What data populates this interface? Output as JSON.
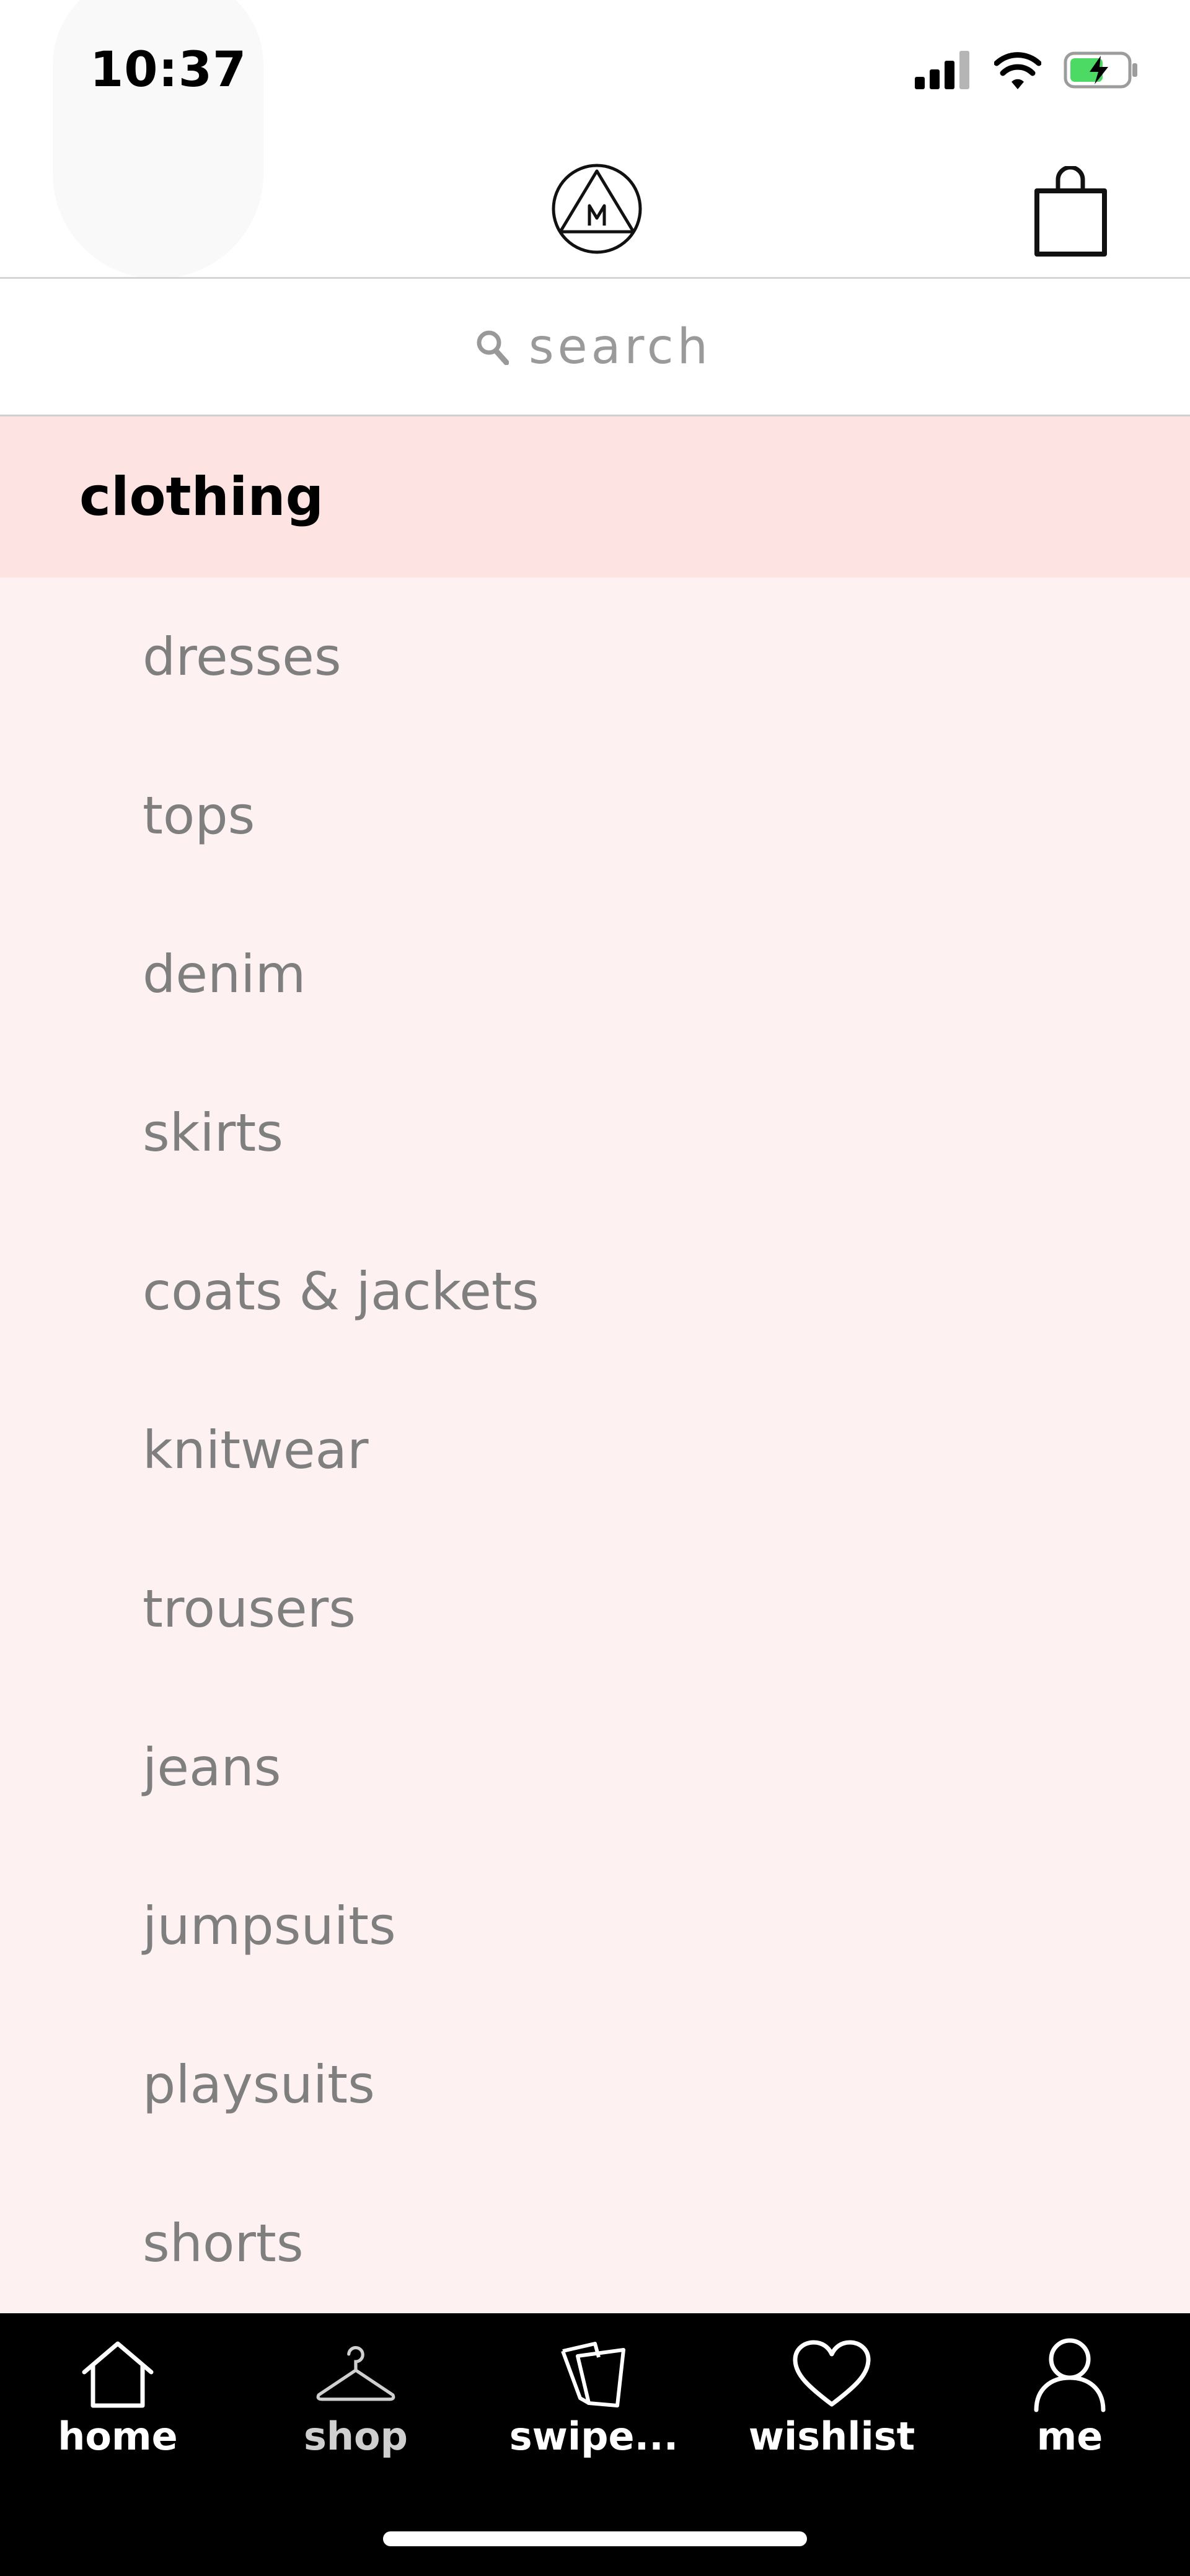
{
  "status_bar": {
    "time": "10:37",
    "icons": [
      "signal-icon",
      "wifi-icon",
      "battery-charging-icon"
    ]
  },
  "header": {
    "logo_letter": "M",
    "icons": [
      "brand-logo-icon",
      "shopping-bag-icon"
    ]
  },
  "search": {
    "placeholder": "search",
    "icon": "search-icon"
  },
  "category": {
    "title": "clothing",
    "items": [
      {
        "label": "dresses"
      },
      {
        "label": "tops"
      },
      {
        "label": "denim"
      },
      {
        "label": "skirts"
      },
      {
        "label": "coats & jackets"
      },
      {
        "label": "knitwear"
      },
      {
        "label": "trousers"
      },
      {
        "label": "jeans"
      },
      {
        "label": "jumpsuits"
      },
      {
        "label": "playsuits"
      },
      {
        "label": "shorts"
      }
    ]
  },
  "tab_bar": {
    "tabs": [
      {
        "label": "home",
        "icon": "home-icon"
      },
      {
        "label": "shop",
        "icon": "hanger-icon"
      },
      {
        "label": "swipe...",
        "icon": "swipe-cards-icon"
      },
      {
        "label": "wishlist",
        "icon": "heart-icon"
      },
      {
        "label": "me",
        "icon": "user-icon"
      }
    ]
  },
  "colors": {
    "category_header_bg": "#fde3e1",
    "list_bg": "#fdf2f1",
    "item_text": "#7f7f7f",
    "tab_bar_bg": "#000000",
    "battery_fill": "#4cd964"
  }
}
